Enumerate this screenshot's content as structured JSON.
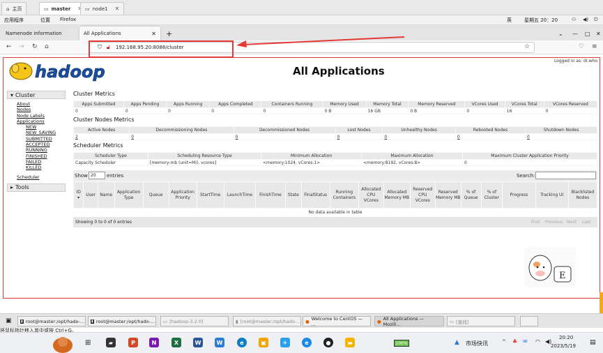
{
  "vm_tabs": [
    {
      "label": "主页"
    },
    {
      "label": "master"
    },
    {
      "label": "node1"
    }
  ],
  "gnome_bar": {
    "apps": "应用程序",
    "places": "位置",
    "app": "Firefox",
    "lang": "英",
    "clock": "星期五 20：20"
  },
  "browser_tabs": [
    {
      "label": "Namenode information"
    },
    {
      "label": "All Applications"
    }
  ],
  "url": "192.168.95.20:8088/cluster",
  "page": {
    "title": "All Applications",
    "logged_in": "Logged in as: dr.who",
    "logo_text": "hadoop"
  },
  "sidebar": {
    "cluster_label": "Cluster",
    "links": [
      "About",
      "Nodes",
      "Node Labels",
      "Applications"
    ],
    "app_states": [
      "NEW",
      "NEW_SAVING",
      "SUBMITTED",
      "ACCEPTED",
      "RUNNING",
      "FINISHED",
      "FAILED",
      "KILLED"
    ],
    "scheduler": "Scheduler",
    "tools_label": "Tools"
  },
  "cluster_metrics": {
    "title": "Cluster Metrics",
    "headers": [
      "Apps Submitted",
      "Apps Pending",
      "Apps Running",
      "Apps Completed",
      "Containers Running",
      "Memory Used",
      "Memory Total",
      "Memory Reserved",
      "VCores Used",
      "VCores Total",
      "VCores Reserved"
    ],
    "values": [
      "0",
      "0",
      "0",
      "0",
      "0",
      "0 B",
      "16 GB",
      "0 B",
      "0",
      "16",
      "0"
    ]
  },
  "node_metrics": {
    "title": "Cluster Nodes Metrics",
    "headers": [
      "Active Nodes",
      "Decommissioning Nodes",
      "Decommissioned Nodes",
      "Lost Nodes",
      "Unhealthy Nodes",
      "Rebooted Nodes",
      "Shutdown Nodes"
    ],
    "values": [
      "2",
      "0",
      "0",
      "0",
      "0",
      "0",
      "0"
    ]
  },
  "scheduler_metrics": {
    "title": "Scheduler Metrics",
    "headers": [
      "Scheduler Type",
      "Scheduling Resource Type",
      "Minimum Allocation",
      "Maximum Allocation",
      "Maximum Cluster Application Priority"
    ],
    "values": [
      "Capacity Scheduler",
      "[memory-mb (unit=Mi), vcores]",
      "<memory:1024, vCores:1>",
      "<memory:8192, vCores:8>",
      "0"
    ]
  },
  "apps_table": {
    "show_label": "Show",
    "entries_value": "20",
    "entries_label": "entries",
    "search_label": "Search:",
    "headers": [
      "ID",
      "User",
      "Name",
      "Application Type",
      "Queue",
      "Application Priority",
      "StartTime",
      "LaunchTime",
      "FinishTime",
      "State",
      "FinalStatus",
      "Running Containers",
      "Allocated CPU VCores",
      "Allocated Memory MB",
      "Reserved CPU VCores",
      "Reserved Memory MB",
      "% of Queue",
      "% of Cluster",
      "Progress",
      "Tracking UI",
      "Blacklisted Nodes"
    ],
    "empty_text": "No data available in table",
    "info": "Showing 0 to 0 of 0 entries",
    "pager": [
      "First",
      "Previous",
      "Next",
      "Last"
    ]
  },
  "taskbar": {
    "items": [
      "root@master:/opt/hado-...",
      "root@master:/opt/hado-...",
      "[hadoop-3.2.0]",
      "[root@master:/opt/hado-...",
      "Welcome to CentOS — ...",
      "All Applications — Mozill...",
      "[查找]"
    ]
  },
  "hint": "将鼠标指针移入其中或按 Ctrl+G。",
  "win_tray": {
    "battery": "100%",
    "news": "市场快讯",
    "time": "20:20",
    "date": "2023/5/19"
  },
  "colors": {
    "highlight": "#e53935",
    "header_bg": "#e8e8e8"
  }
}
